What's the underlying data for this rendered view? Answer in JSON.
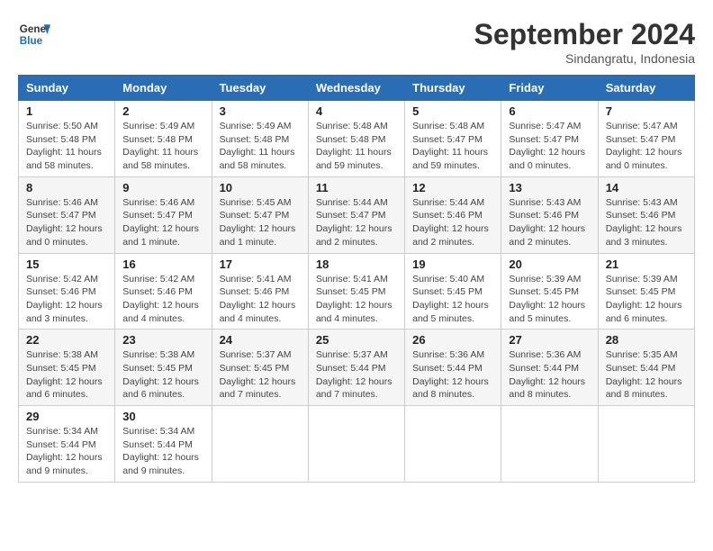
{
  "header": {
    "logo_general": "General",
    "logo_blue": "Blue",
    "month_title": "September 2024",
    "location": "Sindangratu, Indonesia"
  },
  "columns": [
    "Sunday",
    "Monday",
    "Tuesday",
    "Wednesday",
    "Thursday",
    "Friday",
    "Saturday"
  ],
  "weeks": [
    [
      {
        "day": "1",
        "sunrise": "Sunrise: 5:50 AM",
        "sunset": "Sunset: 5:48 PM",
        "daylight": "Daylight: 11 hours and 58 minutes."
      },
      {
        "day": "2",
        "sunrise": "Sunrise: 5:49 AM",
        "sunset": "Sunset: 5:48 PM",
        "daylight": "Daylight: 11 hours and 58 minutes."
      },
      {
        "day": "3",
        "sunrise": "Sunrise: 5:49 AM",
        "sunset": "Sunset: 5:48 PM",
        "daylight": "Daylight: 11 hours and 58 minutes."
      },
      {
        "day": "4",
        "sunrise": "Sunrise: 5:48 AM",
        "sunset": "Sunset: 5:48 PM",
        "daylight": "Daylight: 11 hours and 59 minutes."
      },
      {
        "day": "5",
        "sunrise": "Sunrise: 5:48 AM",
        "sunset": "Sunset: 5:47 PM",
        "daylight": "Daylight: 11 hours and 59 minutes."
      },
      {
        "day": "6",
        "sunrise": "Sunrise: 5:47 AM",
        "sunset": "Sunset: 5:47 PM",
        "daylight": "Daylight: 12 hours and 0 minutes."
      },
      {
        "day": "7",
        "sunrise": "Sunrise: 5:47 AM",
        "sunset": "Sunset: 5:47 PM",
        "daylight": "Daylight: 12 hours and 0 minutes."
      }
    ],
    [
      {
        "day": "8",
        "sunrise": "Sunrise: 5:46 AM",
        "sunset": "Sunset: 5:47 PM",
        "daylight": "Daylight: 12 hours and 0 minutes."
      },
      {
        "day": "9",
        "sunrise": "Sunrise: 5:46 AM",
        "sunset": "Sunset: 5:47 PM",
        "daylight": "Daylight: 12 hours and 1 minute."
      },
      {
        "day": "10",
        "sunrise": "Sunrise: 5:45 AM",
        "sunset": "Sunset: 5:47 PM",
        "daylight": "Daylight: 12 hours and 1 minute."
      },
      {
        "day": "11",
        "sunrise": "Sunrise: 5:44 AM",
        "sunset": "Sunset: 5:47 PM",
        "daylight": "Daylight: 12 hours and 2 minutes."
      },
      {
        "day": "12",
        "sunrise": "Sunrise: 5:44 AM",
        "sunset": "Sunset: 5:46 PM",
        "daylight": "Daylight: 12 hours and 2 minutes."
      },
      {
        "day": "13",
        "sunrise": "Sunrise: 5:43 AM",
        "sunset": "Sunset: 5:46 PM",
        "daylight": "Daylight: 12 hours and 2 minutes."
      },
      {
        "day": "14",
        "sunrise": "Sunrise: 5:43 AM",
        "sunset": "Sunset: 5:46 PM",
        "daylight": "Daylight: 12 hours and 3 minutes."
      }
    ],
    [
      {
        "day": "15",
        "sunrise": "Sunrise: 5:42 AM",
        "sunset": "Sunset: 5:46 PM",
        "daylight": "Daylight: 12 hours and 3 minutes."
      },
      {
        "day": "16",
        "sunrise": "Sunrise: 5:42 AM",
        "sunset": "Sunset: 5:46 PM",
        "daylight": "Daylight: 12 hours and 4 minutes."
      },
      {
        "day": "17",
        "sunrise": "Sunrise: 5:41 AM",
        "sunset": "Sunset: 5:46 PM",
        "daylight": "Daylight: 12 hours and 4 minutes."
      },
      {
        "day": "18",
        "sunrise": "Sunrise: 5:41 AM",
        "sunset": "Sunset: 5:45 PM",
        "daylight": "Daylight: 12 hours and 4 minutes."
      },
      {
        "day": "19",
        "sunrise": "Sunrise: 5:40 AM",
        "sunset": "Sunset: 5:45 PM",
        "daylight": "Daylight: 12 hours and 5 minutes."
      },
      {
        "day": "20",
        "sunrise": "Sunrise: 5:39 AM",
        "sunset": "Sunset: 5:45 PM",
        "daylight": "Daylight: 12 hours and 5 minutes."
      },
      {
        "day": "21",
        "sunrise": "Sunrise: 5:39 AM",
        "sunset": "Sunset: 5:45 PM",
        "daylight": "Daylight: 12 hours and 6 minutes."
      }
    ],
    [
      {
        "day": "22",
        "sunrise": "Sunrise: 5:38 AM",
        "sunset": "Sunset: 5:45 PM",
        "daylight": "Daylight: 12 hours and 6 minutes."
      },
      {
        "day": "23",
        "sunrise": "Sunrise: 5:38 AM",
        "sunset": "Sunset: 5:45 PM",
        "daylight": "Daylight: 12 hours and 6 minutes."
      },
      {
        "day": "24",
        "sunrise": "Sunrise: 5:37 AM",
        "sunset": "Sunset: 5:45 PM",
        "daylight": "Daylight: 12 hours and 7 minutes."
      },
      {
        "day": "25",
        "sunrise": "Sunrise: 5:37 AM",
        "sunset": "Sunset: 5:44 PM",
        "daylight": "Daylight: 12 hours and 7 minutes."
      },
      {
        "day": "26",
        "sunrise": "Sunrise: 5:36 AM",
        "sunset": "Sunset: 5:44 PM",
        "daylight": "Daylight: 12 hours and 8 minutes."
      },
      {
        "day": "27",
        "sunrise": "Sunrise: 5:36 AM",
        "sunset": "Sunset: 5:44 PM",
        "daylight": "Daylight: 12 hours and 8 minutes."
      },
      {
        "day": "28",
        "sunrise": "Sunrise: 5:35 AM",
        "sunset": "Sunset: 5:44 PM",
        "daylight": "Daylight: 12 hours and 8 minutes."
      }
    ],
    [
      {
        "day": "29",
        "sunrise": "Sunrise: 5:34 AM",
        "sunset": "Sunset: 5:44 PM",
        "daylight": "Daylight: 12 hours and 9 minutes."
      },
      {
        "day": "30",
        "sunrise": "Sunrise: 5:34 AM",
        "sunset": "Sunset: 5:44 PM",
        "daylight": "Daylight: 12 hours and 9 minutes."
      },
      null,
      null,
      null,
      null,
      null
    ]
  ]
}
